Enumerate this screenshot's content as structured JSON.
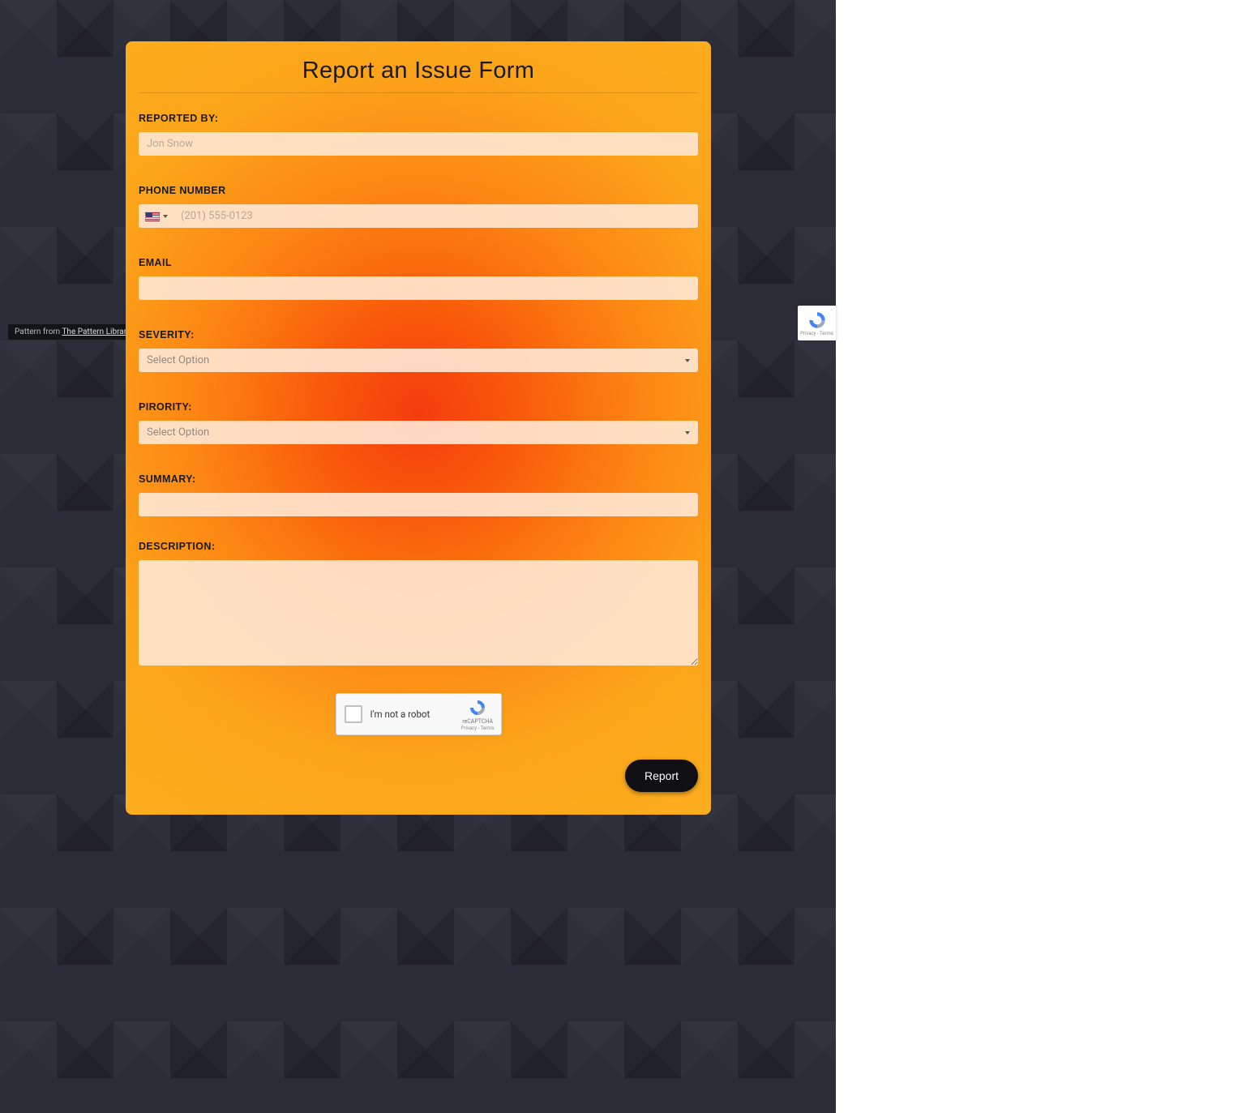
{
  "credit": {
    "prefix": "Pattern from ",
    "link_text": "The Pattern Library"
  },
  "form": {
    "title": "Report an Issue Form",
    "reported_by": {
      "label": "REPORTED BY:",
      "placeholder": "Jon Snow",
      "value": ""
    },
    "phone": {
      "label": "PHONE NUMBER",
      "placeholder": "(201) 555-0123",
      "value": ""
    },
    "email": {
      "label": "EMAIL",
      "value": ""
    },
    "severity": {
      "label": "SEVERITY:",
      "placeholder": "Select Option"
    },
    "priority": {
      "label": "PIRORITY:",
      "placeholder": "Select Option"
    },
    "summary": {
      "label": "SUMMARY:",
      "value": ""
    },
    "description": {
      "label": "DESCRIPTION:",
      "value": ""
    },
    "recaptcha": {
      "label": "I'm not a robot",
      "brand": "reCAPTCHA",
      "terms": "Privacy - Terms"
    },
    "submit": "Report"
  },
  "badge": {
    "terms": "Privacy - Terms"
  }
}
